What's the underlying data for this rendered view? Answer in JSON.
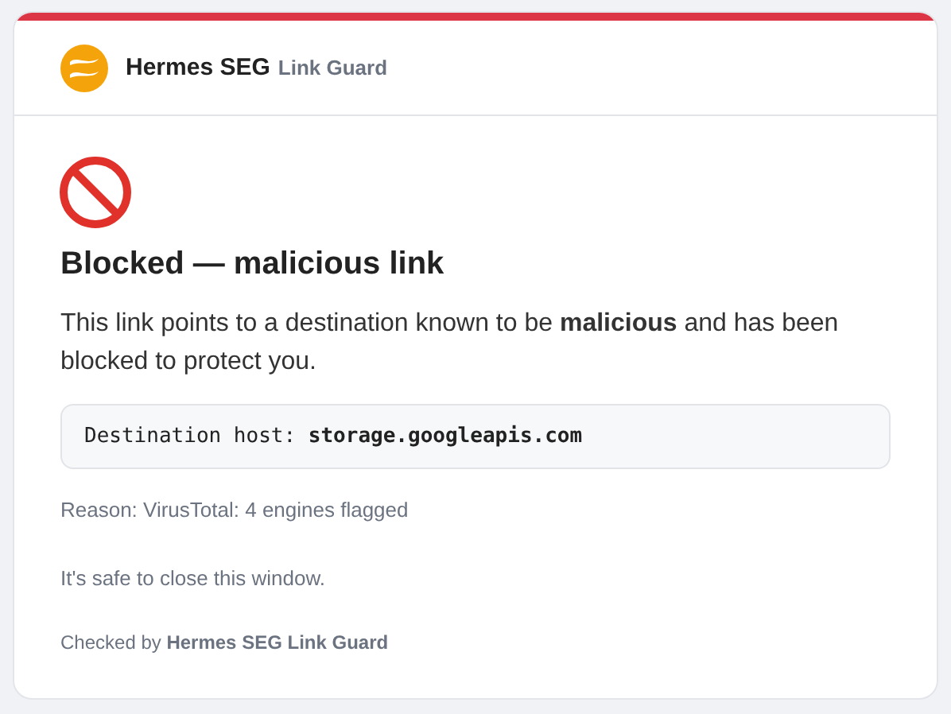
{
  "header": {
    "name": "Hermes SEG",
    "product": "Link Guard"
  },
  "title": "Blocked — malicious link",
  "message": "This link points to a destination known to be **malicious** and has been blocked to protect you.",
  "destination": "Destination host: **storage.googleapis.com**",
  "reason": "Reason: VirusTotal: 4 engines flagged",
  "note": "It's safe to close this window.",
  "footer": "Checked by **Hermes SEG Link Guard**"
}
